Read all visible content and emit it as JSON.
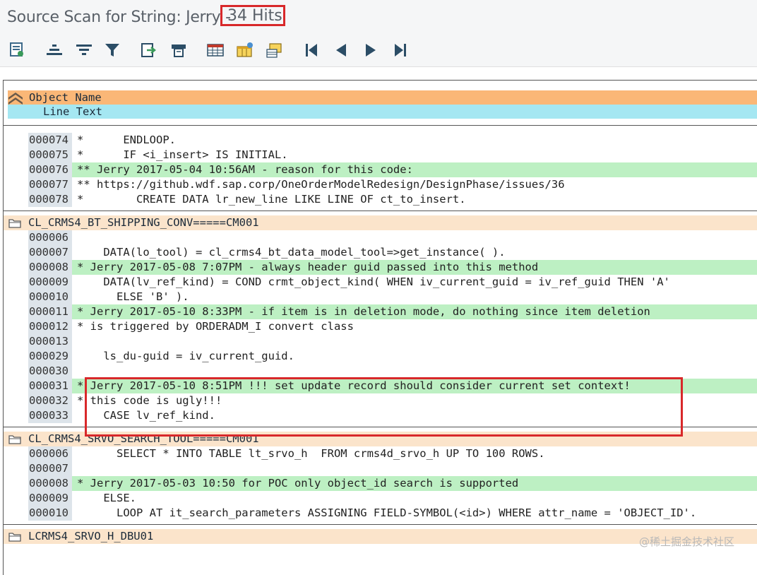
{
  "window": {
    "title": "Source Scan for String: Jerry -",
    "hits": "34 Hits"
  },
  "toolbar": {
    "icons": [
      "details-icon",
      "ascending-sort-icon",
      "descending-sort-icon",
      "filter-icon",
      "export-icon",
      "print-icon",
      "layout-table-icon",
      "change-layout-icon",
      "save-layout-icon",
      "first-page-icon",
      "previous-page-icon",
      "next-page-icon",
      "last-page-icon"
    ]
  },
  "header": {
    "col1": "Object Name",
    "col2": "Line Text"
  },
  "sections": [
    {
      "object": "",
      "lines": [
        {
          "ln": "000074",
          "text": "*      ENDLOOP.",
          "hl": false
        },
        {
          "ln": "000075",
          "text": "*      IF <i_insert> IS INITIAL.",
          "hl": false
        },
        {
          "ln": "000076",
          "text": "** Jerry 2017-05-04 10:56AM - reason for this code:",
          "hl": true
        },
        {
          "ln": "000077",
          "text": "** https://github.wdf.sap.corp/OneOrderModelRedesign/DesignPhase/issues/36",
          "hl": false
        },
        {
          "ln": "000078",
          "text": "*        CREATE DATA lr_new_line LIKE LINE OF ct_to_insert.",
          "hl": false
        }
      ]
    },
    {
      "object": "CL_CRMS4_BT_SHIPPING_CONV=====CM001",
      "lines": [
        {
          "ln": "000006",
          "text": "",
          "hl": false
        },
        {
          "ln": "000007",
          "text": "    DATA(lo_tool) = cl_crms4_bt_data_model_tool=>get_instance( ).",
          "hl": false
        },
        {
          "ln": "000008",
          "text": "* Jerry 2017-05-08 7:07PM - always header guid passed into this method",
          "hl": true
        },
        {
          "ln": "000009",
          "text": "    DATA(lv_ref_kind) = COND crmt_object_kind( WHEN iv_current_guid = iv_ref_guid THEN 'A'",
          "hl": false
        },
        {
          "ln": "000010",
          "text": "      ELSE 'B' ).",
          "hl": false
        },
        {
          "ln": "000011",
          "text": "* Jerry 2017-05-10 8:33PM - if item is in deletion mode, do nothing since item deletion",
          "hl": true
        },
        {
          "ln": "000012",
          "text": "* is triggered by ORDERADM_I convert class",
          "hl": false
        },
        {
          "ln": "000013",
          "text": "",
          "hl": false
        },
        {
          "ln": "000029",
          "text": "    ls_du-guid = iv_current_guid.",
          "hl": false
        },
        {
          "ln": "000030",
          "text": "",
          "hl": false
        },
        {
          "ln": "000031",
          "text": "* Jerry 2017-05-10 8:51PM !!! set update record should consider current set context!",
          "hl": true
        },
        {
          "ln": "000032",
          "text": "* this code is ugly!!!",
          "hl": false
        },
        {
          "ln": "000033",
          "text": "    CASE lv_ref_kind.",
          "hl": false
        }
      ]
    },
    {
      "object": "CL_CRMS4_SRVO_SEARCH_TOOL=====CM001",
      "lines": [
        {
          "ln": "000006",
          "text": "      SELECT * INTO TABLE lt_srvo_h  FROM crms4d_srvo_h UP TO 100 ROWS.",
          "hl": false
        },
        {
          "ln": "000007",
          "text": "",
          "hl": false
        },
        {
          "ln": "000008",
          "text": "* Jerry 2017-05-03 10:50 for POC only object_id search is supported",
          "hl": true
        },
        {
          "ln": "000009",
          "text": "    ELSE.",
          "hl": false
        },
        {
          "ln": "000010",
          "text": "      LOOP AT it_search_parameters ASSIGNING FIELD-SYMBOL(<id>) WHERE attr_name = 'OBJECT_ID'.",
          "hl": false
        }
      ]
    },
    {
      "object": "LCRMS4_SRVO_H_DBU01",
      "lines": []
    }
  ],
  "watermark": "@稀土掘金技术社区",
  "colors": {
    "header_object": "#fab777",
    "header_line": "#a5e7f2",
    "object_row": "#fbe4cb",
    "highlight": "#bdf0c3",
    "line_number_bg": "#dde4ea",
    "annotation_red": "#d8282a"
  }
}
